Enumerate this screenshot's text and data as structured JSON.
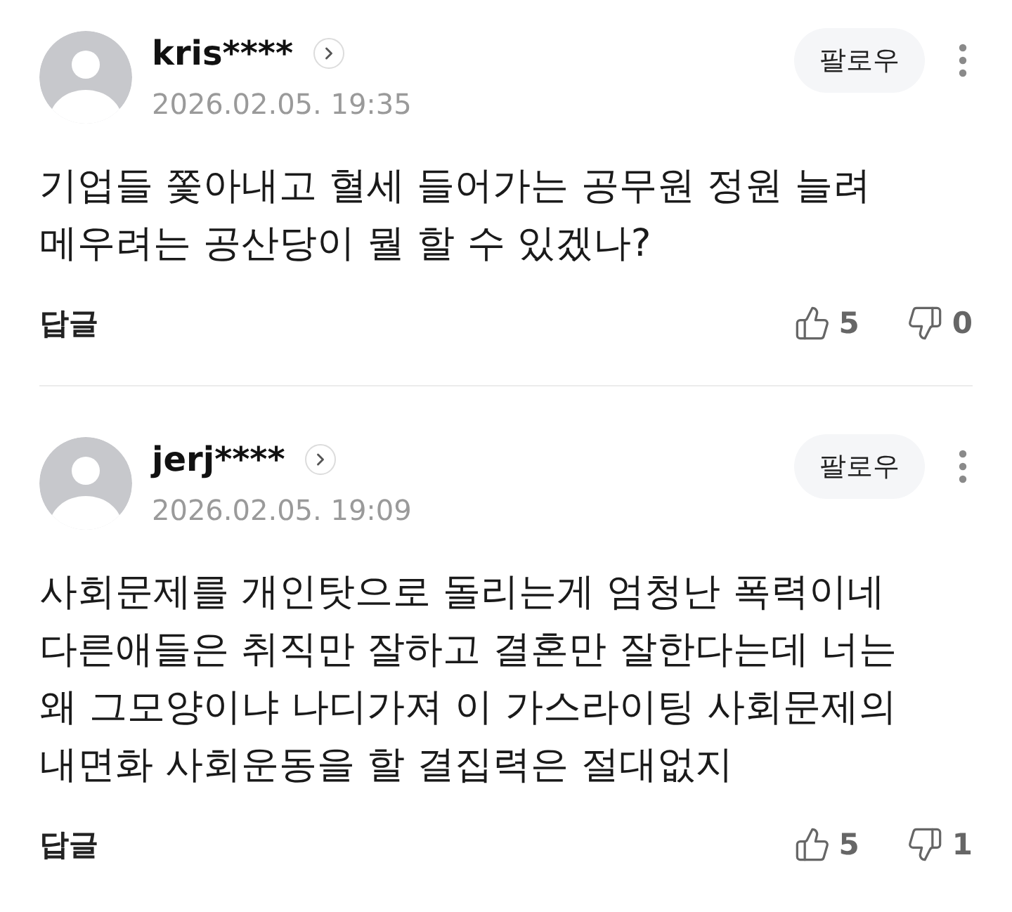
{
  "comments": [
    {
      "username": "kris****",
      "date": "2026.02.05. 19:35",
      "follow_label": "팔로우",
      "lines": [
        "기업들 쫓아내고 혈세 들어가는 공무원 정원 늘려",
        "메우려는 공산당이 뭘 할 수 있겠나?"
      ],
      "reply_label": "답글",
      "likes": "5",
      "dislikes": "0"
    },
    {
      "username": "jerj****",
      "date": "2026.02.05. 19:09",
      "follow_label": "팔로우",
      "lines": [
        "사회문제를 개인탓으로 돌리는게 엄청난 폭력이네",
        "다른애들은 취직만 잘하고 결혼만 잘한다는데 너는",
        "왜 그모양이냐 나디가져 이 가스라이팅 사회문제의",
        "내면화 사회운동을 할 결집력은 절대없지"
      ],
      "reply_label": "답글",
      "likes": "5",
      "dislikes": "1"
    }
  ]
}
